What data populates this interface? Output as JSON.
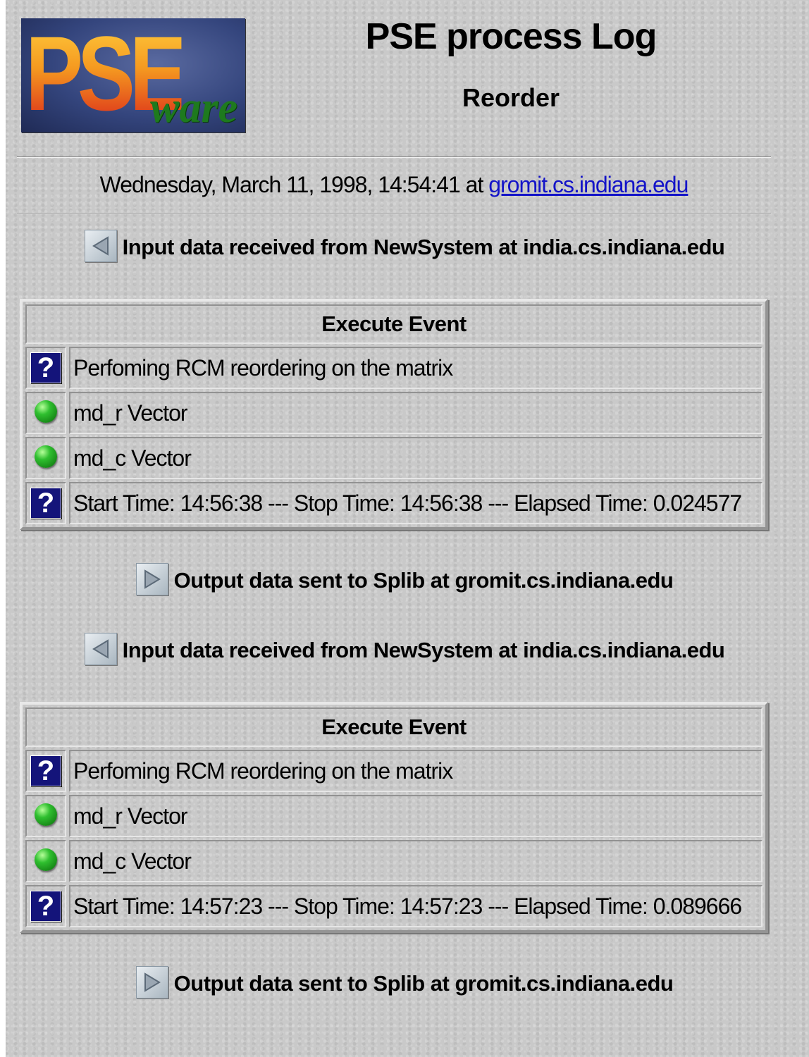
{
  "header": {
    "logo_text": "PSE",
    "logo_subtext": "ware",
    "title": "PSE process Log",
    "subtitle": "Reorder"
  },
  "date_line": {
    "text": "Wednesday, March 11, 1998, 14:54:41 at ",
    "host_link": "gromit.cs.indiana.edu"
  },
  "events": [
    {
      "input_text": "Input data received from NewSystem at india.cs.indiana.edu",
      "table": {
        "header": "Execute Event",
        "rows": [
          {
            "icon": "question-icon",
            "text": "Perfoming RCM reordering on the matrix"
          },
          {
            "icon": "green-dot-icon",
            "text": "md_r Vector"
          },
          {
            "icon": "green-dot-icon",
            "text": "md_c Vector"
          },
          {
            "icon": "question-icon",
            "text": "Start Time: 14:56:38 --- Stop Time: 14:56:38 --- Elapsed Time: 0.024577"
          }
        ]
      },
      "output_text": "Output data sent to Splib at gromit.cs.indiana.edu"
    },
    {
      "input_text": "Input data received from NewSystem at india.cs.indiana.edu",
      "table": {
        "header": "Execute Event",
        "rows": [
          {
            "icon": "question-icon",
            "text": "Perfoming RCM reordering on the matrix"
          },
          {
            "icon": "green-dot-icon",
            "text": "md_r Vector"
          },
          {
            "icon": "green-dot-icon",
            "text": "md_c Vector"
          },
          {
            "icon": "question-icon",
            "text": "Start Time: 14:57:23 --- Stop Time: 14:57:23 --- Elapsed Time: 0.089666"
          }
        ]
      },
      "output_text": "Output data sent to Splib at gromit.cs.indiana.edu"
    }
  ]
}
